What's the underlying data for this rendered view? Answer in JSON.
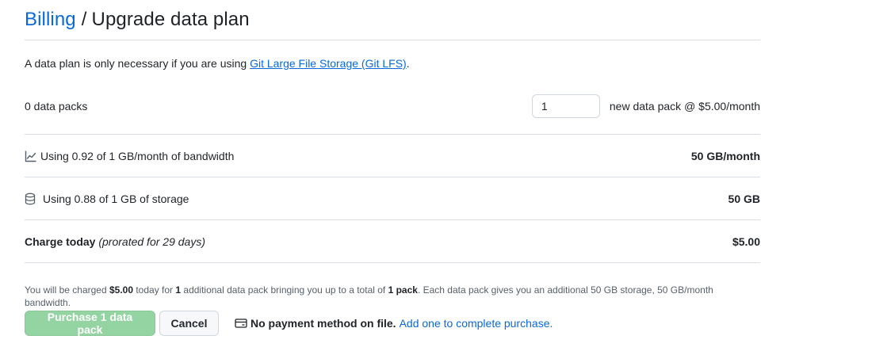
{
  "breadcrumb": {
    "parent": "Billing",
    "separator": "/",
    "current": "Upgrade data plan"
  },
  "intro": {
    "text": "A data plan is only necessary if you are using ",
    "link": "Git Large File Storage (Git LFS)",
    "suffix": "."
  },
  "packs": {
    "label": "0 data packs",
    "quantity": "1",
    "price_text": "new data pack @ $5.00/month"
  },
  "bandwidth": {
    "icon": "graph-icon",
    "label": "Using 0.92 of 1 GB/month of bandwidth",
    "value": "50 GB/month"
  },
  "storage": {
    "icon": "database-icon",
    "label": "Using 0.88 of 1 GB of storage",
    "value": "50 GB"
  },
  "charge": {
    "label": "Charge today",
    "note": "(prorated for 29 days)",
    "value": "$5.00"
  },
  "summary": {
    "t1": "You will be charged ",
    "amount": "$5.00",
    "t2": " today for ",
    "count": "1",
    "t3": " additional data pack bringing you up to a total of ",
    "total": "1 pack",
    "t4": ". Each data pack gives you an additional 50 GB storage, 50 GB/month bandwidth."
  },
  "actions": {
    "purchase": "Purchase 1 data pack",
    "cancel": "Cancel"
  },
  "payment": {
    "icon": "credit-card-icon",
    "message": "No payment method on file.",
    "link": "Add one to complete purchase."
  },
  "colors": {
    "link": "#0969da",
    "primary_disabled": "#94d3a2",
    "border": "#d8dee4"
  }
}
